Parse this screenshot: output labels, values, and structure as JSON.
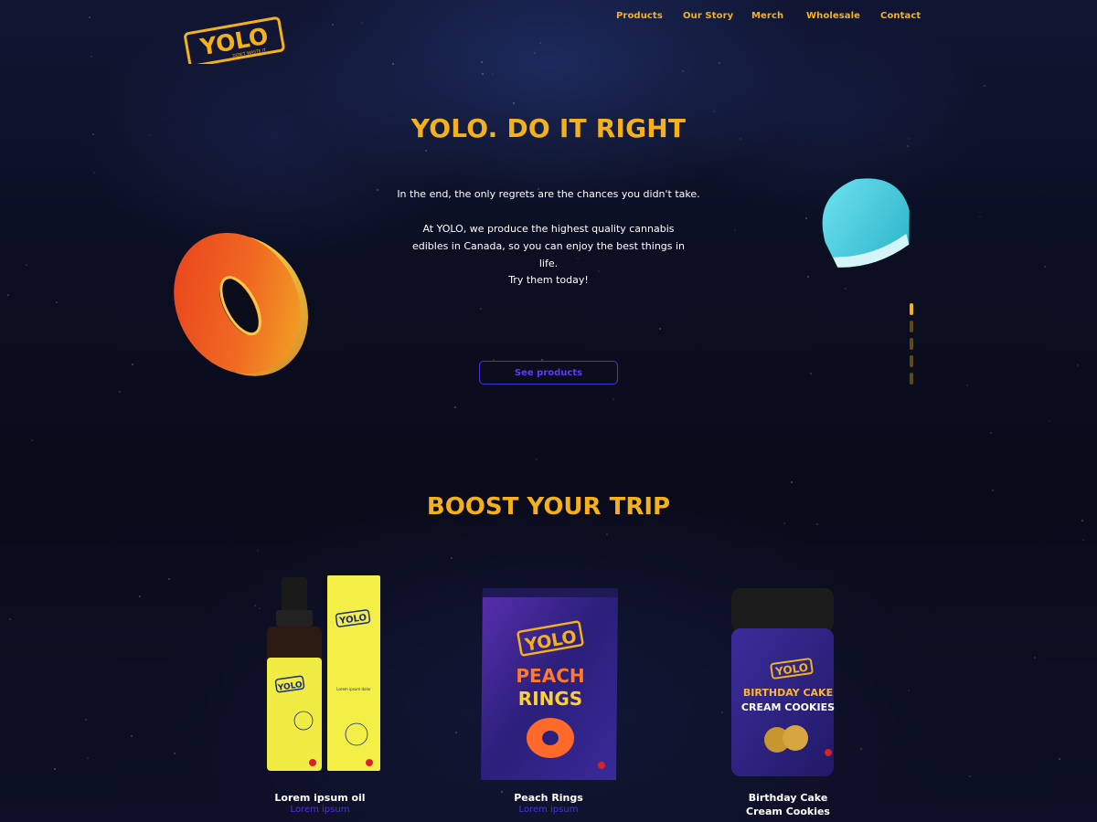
{
  "logo": {
    "wordmark": "YOLO",
    "tagline": "DON'T WASTE IT"
  },
  "nav": {
    "items": [
      "Products",
      "Our Story",
      "Merch",
      "Wholesale",
      "Contact"
    ]
  },
  "hero": {
    "title": "YOLO. DO IT RIGHT",
    "line1": "In the end, the only regrets are the chances you didn't take.",
    "line2": "At YOLO, we produce the highest quality cannabis edibles in Canada, so you can enjoy the best things in life.",
    "line3": "Try them today!",
    "cta": "See products"
  },
  "slider": {
    "count": 5,
    "active_index": 0
  },
  "section": {
    "title": "BOOST YOUR TRIP"
  },
  "products": [
    {
      "name": "Lorem ipsum oil",
      "sub": "Lorem ipsum",
      "pack_text": "YOLO",
      "label_text": "Lorem ipsum dolor"
    },
    {
      "name": "Peach Rings",
      "sub": "Lorem ipsum",
      "pack_text": "YOLO",
      "pack_line1": "PEACH",
      "pack_line2": "RINGS"
    },
    {
      "name": "Birthday Cake Cream Cookies",
      "name_line1": "Birthday Cake",
      "name_line2": "Cream Cookies",
      "pack_text": "YOLO",
      "pack_line1": "BIRTHDAY CAKE",
      "pack_line2": "CREAM COOKIES"
    }
  ],
  "colors": {
    "accent": "#f5b11b",
    "cta": "#4733d6",
    "background": "#0b0d1a"
  }
}
